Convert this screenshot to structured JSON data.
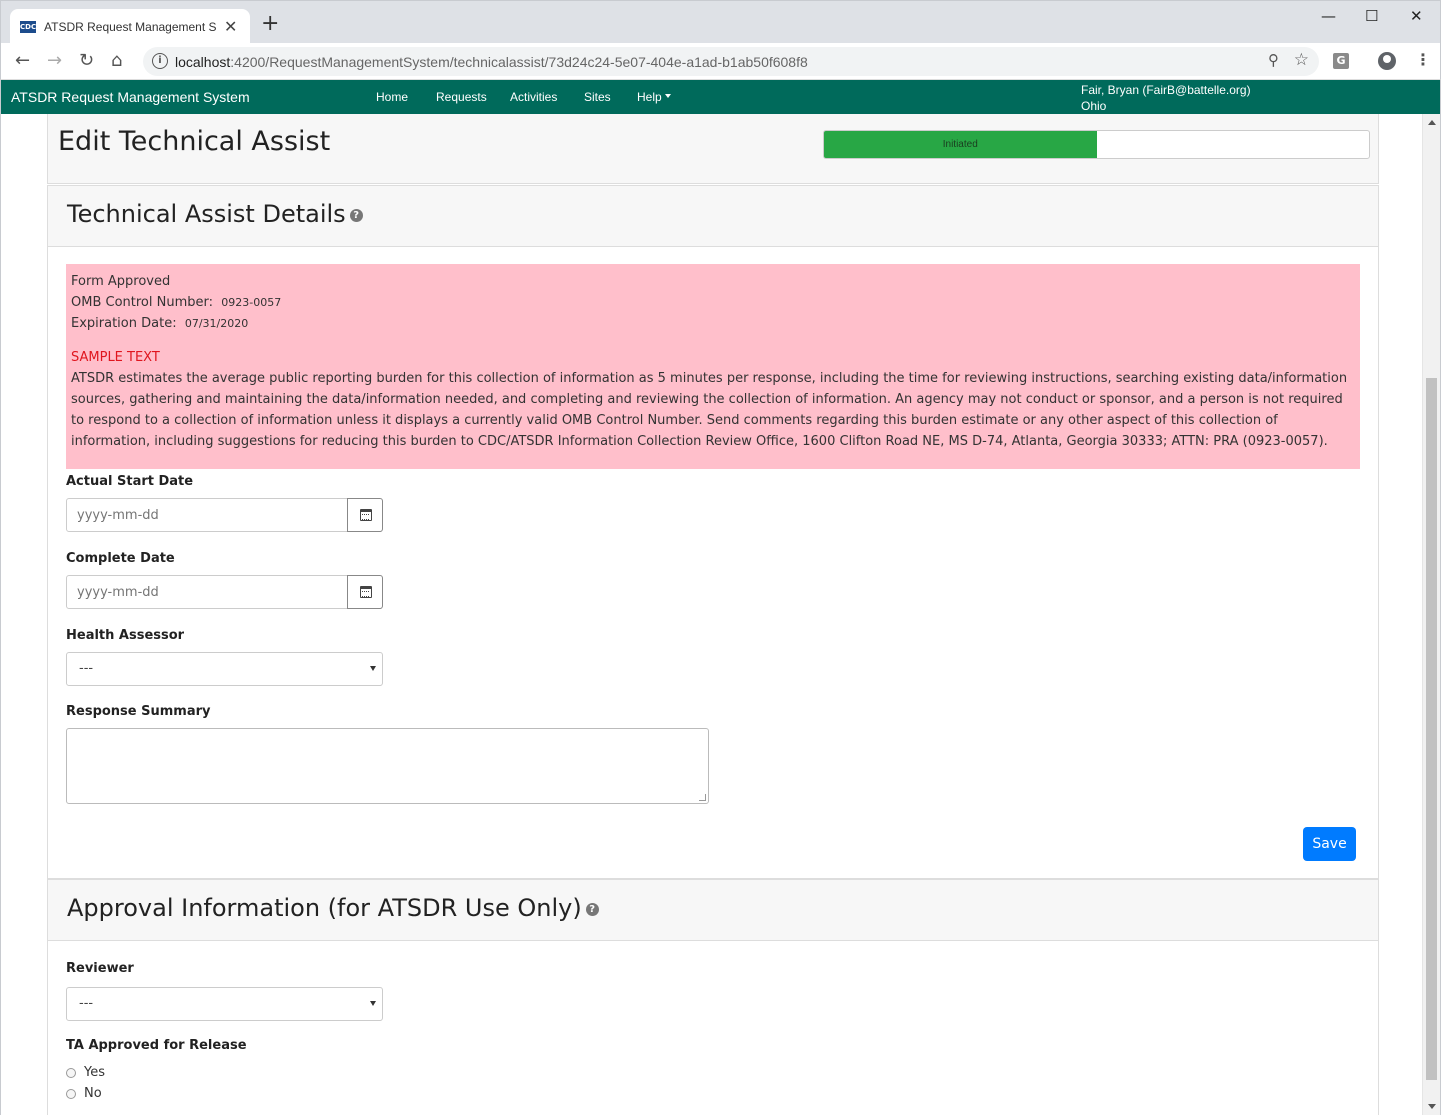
{
  "browser": {
    "tab_title": "ATSDR Request Management System",
    "favicon_text": "CDC",
    "url_host": "localhost",
    "url_path": ":4200/RequestManagementSystem/technicalassist/73d24c24-5e07-404e-a1ad-b1ab50f608f8",
    "extension_letter": "G"
  },
  "navbar": {
    "brand": "ATSDR Request Management System",
    "links": [
      "Home",
      "Requests",
      "Activities",
      "Sites",
      "Help"
    ],
    "user_name": "Fair, Bryan (FairB@battelle.org)",
    "user_state": "Ohio",
    "color": "#006a5b"
  },
  "page": {
    "title": "Edit Technical Assist",
    "progress_label": "Initiated",
    "progress_value": 0.5,
    "progress_color": "#28a745"
  },
  "details": {
    "title": "Technical Assist Details",
    "notice": {
      "form_approved": "Form Approved",
      "omb_label": "OMB Control Number:",
      "omb_value": "0923-0057",
      "exp_label": "Expiration Date:",
      "exp_value": "07/31/2020",
      "sample": "SAMPLE TEXT",
      "body": "ATSDR estimates the average public reporting burden for this collection of information as 5 minutes per response, including the time for reviewing instructions, searching existing data/information sources, gathering and maintaining the data/information needed, and completing and reviewing the collection of information. An agency may not conduct or sponsor, and a person is not required to respond to a collection of information unless it displays a currently valid OMB Control Number. Send comments regarding this burden estimate or any other aspect of this collection of information, including suggestions for reducing this burden to CDC/ATSDR Information Collection Review Office, 1600 Clifton Road NE, MS D-74, Atlanta, Georgia 30333; ATTN: PRA (0923-0057)."
    },
    "start_label": "Actual Start Date",
    "start_placeholder": "yyyy-mm-dd",
    "complete_label": "Complete Date",
    "complete_placeholder": "yyyy-mm-dd",
    "assessor_label": "Health Assessor",
    "assessor_value": "---",
    "summary_label": "Response Summary",
    "save_label": "Save"
  },
  "approval": {
    "title": "Approval Information (for ATSDR Use Only)",
    "reviewer_label": "Reviewer",
    "reviewer_value": "---",
    "release_label": "TA Approved for Release",
    "options": [
      "Yes",
      "No"
    ]
  }
}
